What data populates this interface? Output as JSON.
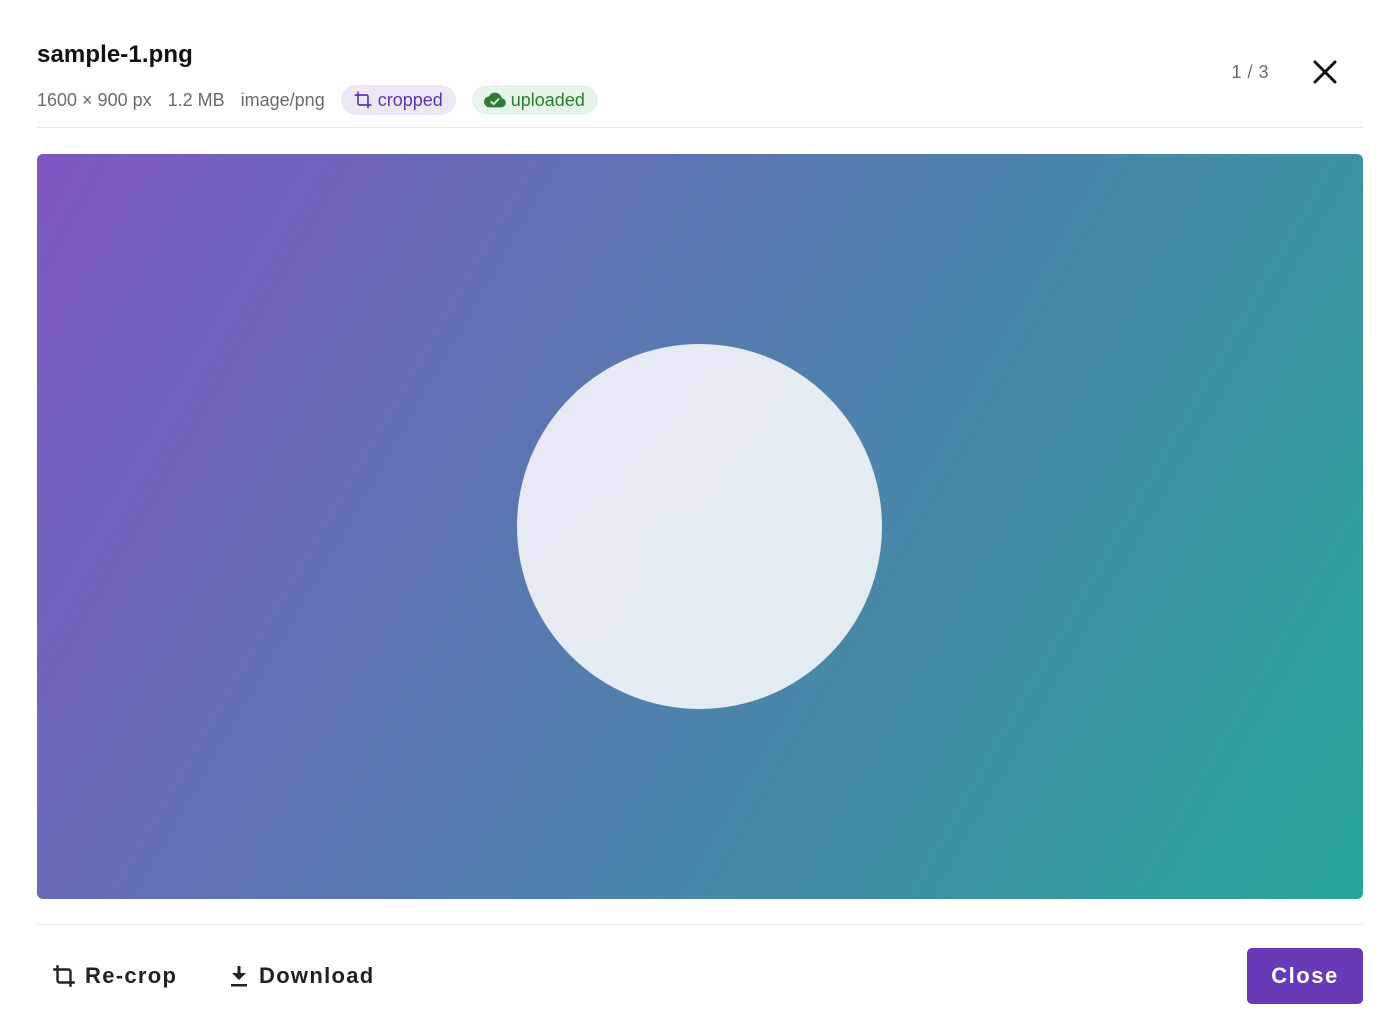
{
  "header": {
    "title": "sample-1.png",
    "dimensions": "1600 × 900 px",
    "size": "1.2 MB",
    "mime": "image/png",
    "chips": {
      "cropped": "cropped",
      "uploaded": "uploaded"
    },
    "counter": "1 / 3"
  },
  "icons": {
    "close": "close-icon",
    "crop": "crop-icon",
    "cloud_done": "cloud-done-icon",
    "download": "download-icon"
  },
  "colors": {
    "accent": "#673ab7",
    "cropped_chip_bg": "#ede7f6",
    "cropped_chip_fg": "#5e35b1",
    "uploaded_chip_bg": "#e6f4ea",
    "uploaded_chip_fg": "#2e7d32",
    "gradient_start": "#7e57c2",
    "gradient_end": "#26a69a"
  },
  "footer": {
    "recrop_label": "Re-crop",
    "download_label": "Download",
    "close_label": "Close"
  }
}
